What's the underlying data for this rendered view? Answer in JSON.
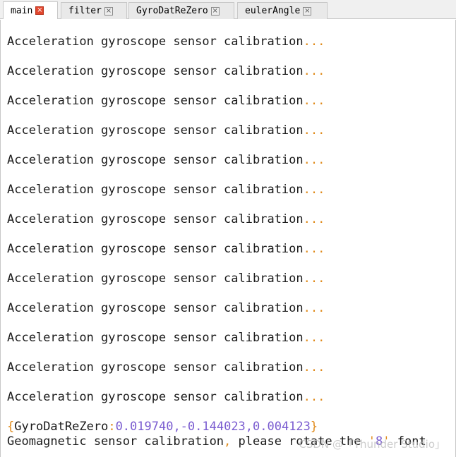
{
  "tabs": [
    {
      "label": "main",
      "active": true
    },
    {
      "label": "filter",
      "active": false
    },
    {
      "label": "GyroDatReZero",
      "active": false
    },
    {
      "label": "eulerAngle",
      "active": false
    }
  ],
  "close_glyph": "×",
  "log": {
    "calib_text": "Acceleration gyroscope sensor calibration",
    "calib_dots": "...",
    "repeat_count_visible": 13,
    "gyro_open": "{",
    "gyro_key": "GyroDatReZero",
    "gyro_colon": ":",
    "gyro_values": "0.019740,-0.144023,0.004123",
    "gyro_close": "}",
    "geo_part1": "Geomagnetic sensor calibration",
    "geo_comma": ",",
    "geo_part2": " please rotate the ",
    "geo_quote_open": "'",
    "geo_eight": "8",
    "geo_quote_close": "'",
    "geo_part3": " font"
  },
  "watermark": "CSDN @「Thunder Studio」",
  "colors": {
    "text": "#1a1a1a",
    "dots": "#e08a1a",
    "number": "#7a5cd0",
    "active_close": "#e2462d"
  }
}
